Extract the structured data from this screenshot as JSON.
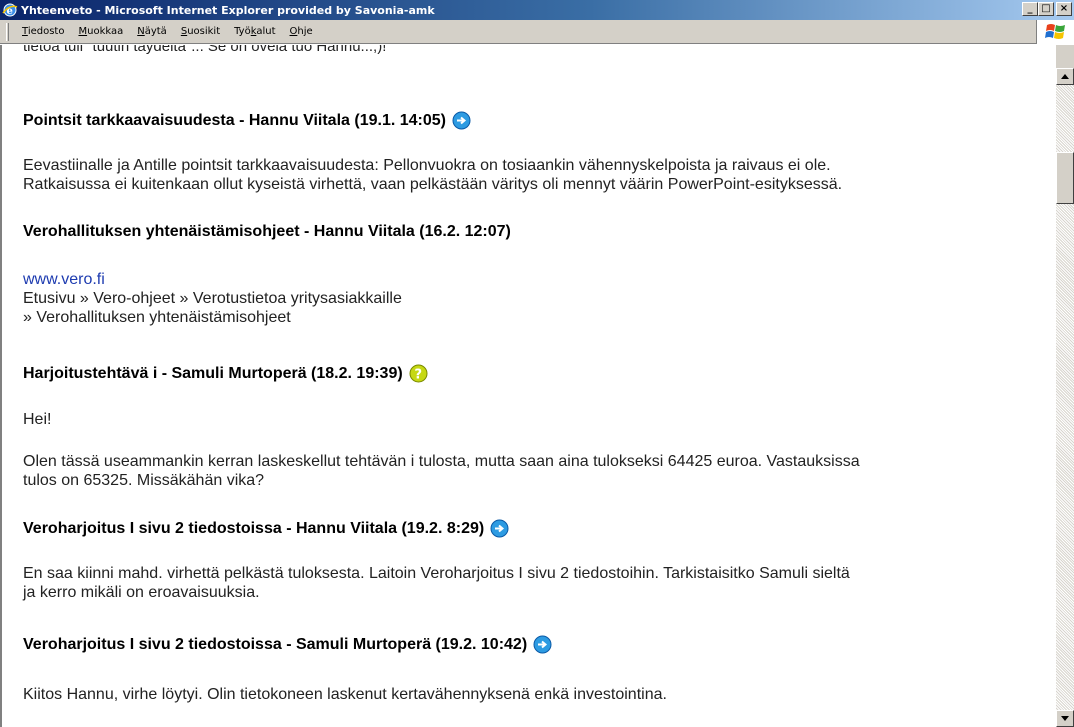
{
  "window": {
    "title": "Yhteenveto - Microsoft Internet Explorer provided by Savonia-amk",
    "buttons": {
      "minimize": "_",
      "maximize": "□",
      "close": "×"
    }
  },
  "menu": {
    "items": [
      {
        "first": "T",
        "rest": "iedosto"
      },
      {
        "first": "M",
        "rest": "uokkaa"
      },
      {
        "first": "N",
        "rest": "äytä"
      },
      {
        "first": "S",
        "rest": "uosikit"
      },
      {
        "prefix": "Työ",
        "first": "k",
        "rest": "alut"
      },
      {
        "first": "O",
        "rest": "hje"
      }
    ]
  },
  "content": {
    "clipped_line": "tietoa tuli \"tuutin täydeltä\"... Se on ovela tuo Hannu...;)!",
    "posts": [
      {
        "title": "Pointsit tarkkaavaisuudesta - Hannu Viitala (19.1. 14:05)",
        "icon": "arrow-right-icon",
        "body_lines": [
          "Eevastiinalle ja Antille pointsit tarkkaavaisuudesta: Pellonvuokra on tosiaankin vähennyskelpoista ja raivaus ei ole.",
          "Ratkaisussa ei kuitenkaan ollut kyseistä virhettä, vaan pelkästään väritys oli mennyt väärin PowerPoint-esityksessä."
        ]
      },
      {
        "title": "Verohallituksen yhtenäistämisohjeet - Hannu Viitala (16.2. 12:07)",
        "icon": "",
        "link": "www.vero.fi",
        "body_lines": [
          "Etusivu » Vero-ohjeet » Verotustietoa yritysasiakkaille",
          "» Verohallituksen yhtenäistämisohjeet"
        ]
      },
      {
        "title": "Harjoitustehtävä i - Samuli Murtoperä (18.2. 19:39)",
        "icon": "question-icon",
        "greeting": "Hei!",
        "body_lines": [
          "Olen tässä useammankin kerran laskeskellut tehtävän i tulosta, mutta saan aina tulokseksi 64425 euroa. Vastauksissa",
          "tulos on 65325. Missäkähän vika?"
        ]
      },
      {
        "title": "Veroharjoitus I sivu 2 tiedostoissa - Hannu Viitala (19.2. 8:29)",
        "icon": "arrow-right-icon",
        "body_lines": [
          "En saa kiinni mahd. virhettä pelkästä tuloksesta. Laitoin Veroharjoitus I sivu 2 tiedostoihin. Tarkistaisitko Samuli sieltä",
          "ja kerro mikäli on eroavaisuuksia."
        ]
      },
      {
        "title": "Veroharjoitus I sivu 2 tiedostoissa - Samuli Murtoperä (19.2. 10:42)",
        "icon": "arrow-right-icon",
        "body_lines": [
          "Kiitos Hannu, virhe löytyi. Olin tietokoneen laskenut kertavähennyksenä enkä investointina."
        ]
      }
    ]
  }
}
